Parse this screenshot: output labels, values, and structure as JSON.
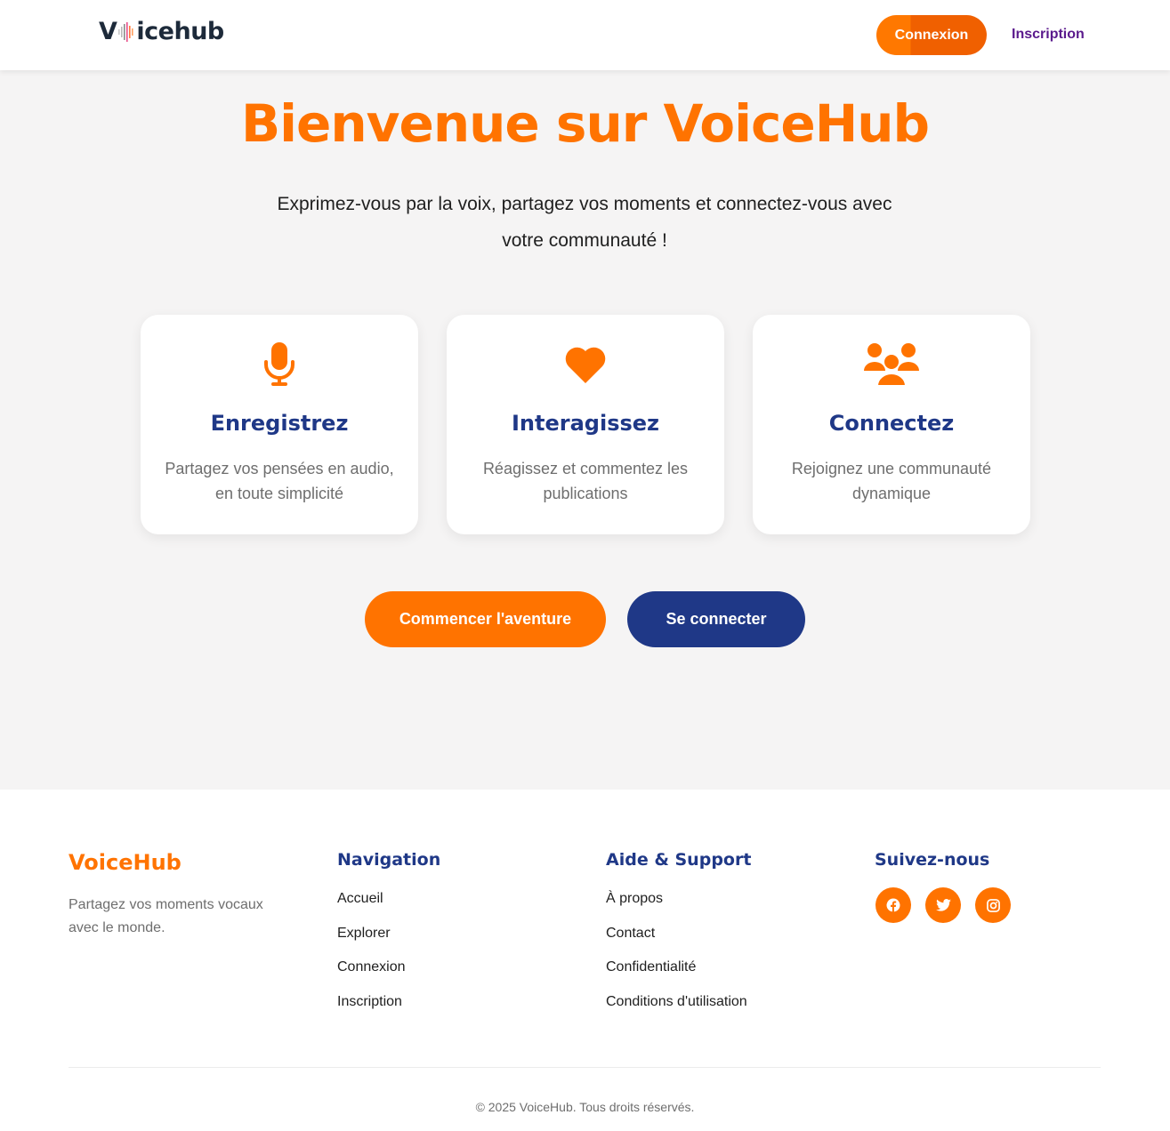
{
  "header": {
    "logo_prefix": "V",
    "logo_suffix": "icehub",
    "login_label": "Connexion",
    "signup_label": "Inscription"
  },
  "hero": {
    "title": "Bienvenue sur VoiceHub",
    "subtitle": "Exprimez-vous par la voix, partagez vos moments et connectez-vous avec votre communauté !"
  },
  "features": [
    {
      "icon": "microphone-icon",
      "title": "Enregistrez",
      "text": "Partagez vos pensées en audio, en toute simplicité"
    },
    {
      "icon": "heart-icon",
      "title": "Interagissez",
      "text": "Réagissez et commentez les publications"
    },
    {
      "icon": "users-icon",
      "title": "Connectez",
      "text": "Rejoignez une communauté dynamique"
    }
  ],
  "cta": {
    "start_label": "Commencer l'aventure",
    "connect_label": "Se connecter"
  },
  "footer": {
    "brand": "VoiceHub",
    "tagline": "Partagez vos moments vocaux avec le monde.",
    "navigation": {
      "title": "Navigation",
      "items": [
        "Accueil",
        "Explorer",
        "Connexion",
        "Inscription"
      ]
    },
    "support": {
      "title": "Aide & Support",
      "items": [
        "À propos",
        "Contact",
        "Confidentialité",
        "Conditions d'utilisation"
      ]
    },
    "social": {
      "title": "Suivez-nous",
      "icons": [
        "facebook-icon",
        "twitter-icon",
        "instagram-icon"
      ]
    },
    "copyright": "© 2025 VoiceHub. Tous droits réservés."
  },
  "colors": {
    "accent": "#ff7300",
    "primary": "#1f3887",
    "signup_link": "#5a1a8c"
  }
}
